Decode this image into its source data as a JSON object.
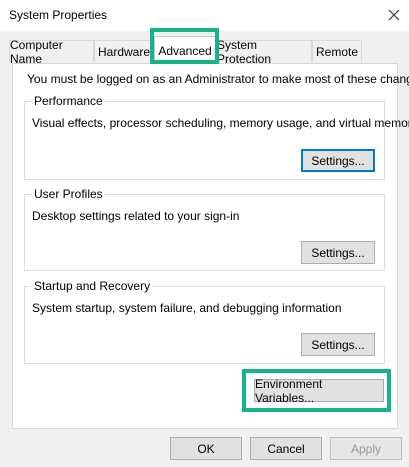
{
  "window": {
    "title": "System Properties"
  },
  "tabs": [
    {
      "label": "Computer Name"
    },
    {
      "label": "Hardware"
    },
    {
      "label": "Advanced"
    },
    {
      "label": "System Protection"
    },
    {
      "label": "Remote"
    }
  ],
  "active_tab": "Advanced",
  "advanced": {
    "intro": "You must be logged on as an Administrator to make most of these changes.",
    "performance": {
      "title": "Performance",
      "description": "Visual effects, processor scheduling, memory usage, and virtual memory",
      "button": "Settings..."
    },
    "user_profiles": {
      "title": "User Profiles",
      "description": "Desktop settings related to your sign-in",
      "button": "Settings..."
    },
    "startup_recovery": {
      "title": "Startup and Recovery",
      "description": "System startup, system failure, and debugging information",
      "button": "Settings..."
    },
    "env_button": "Environment Variables..."
  },
  "footer": {
    "ok": "OK",
    "cancel": "Cancel",
    "apply": "Apply"
  },
  "colors": {
    "highlight": "#16b28a",
    "focus": "#0078d7"
  },
  "icons": {
    "close": "close-icon"
  }
}
